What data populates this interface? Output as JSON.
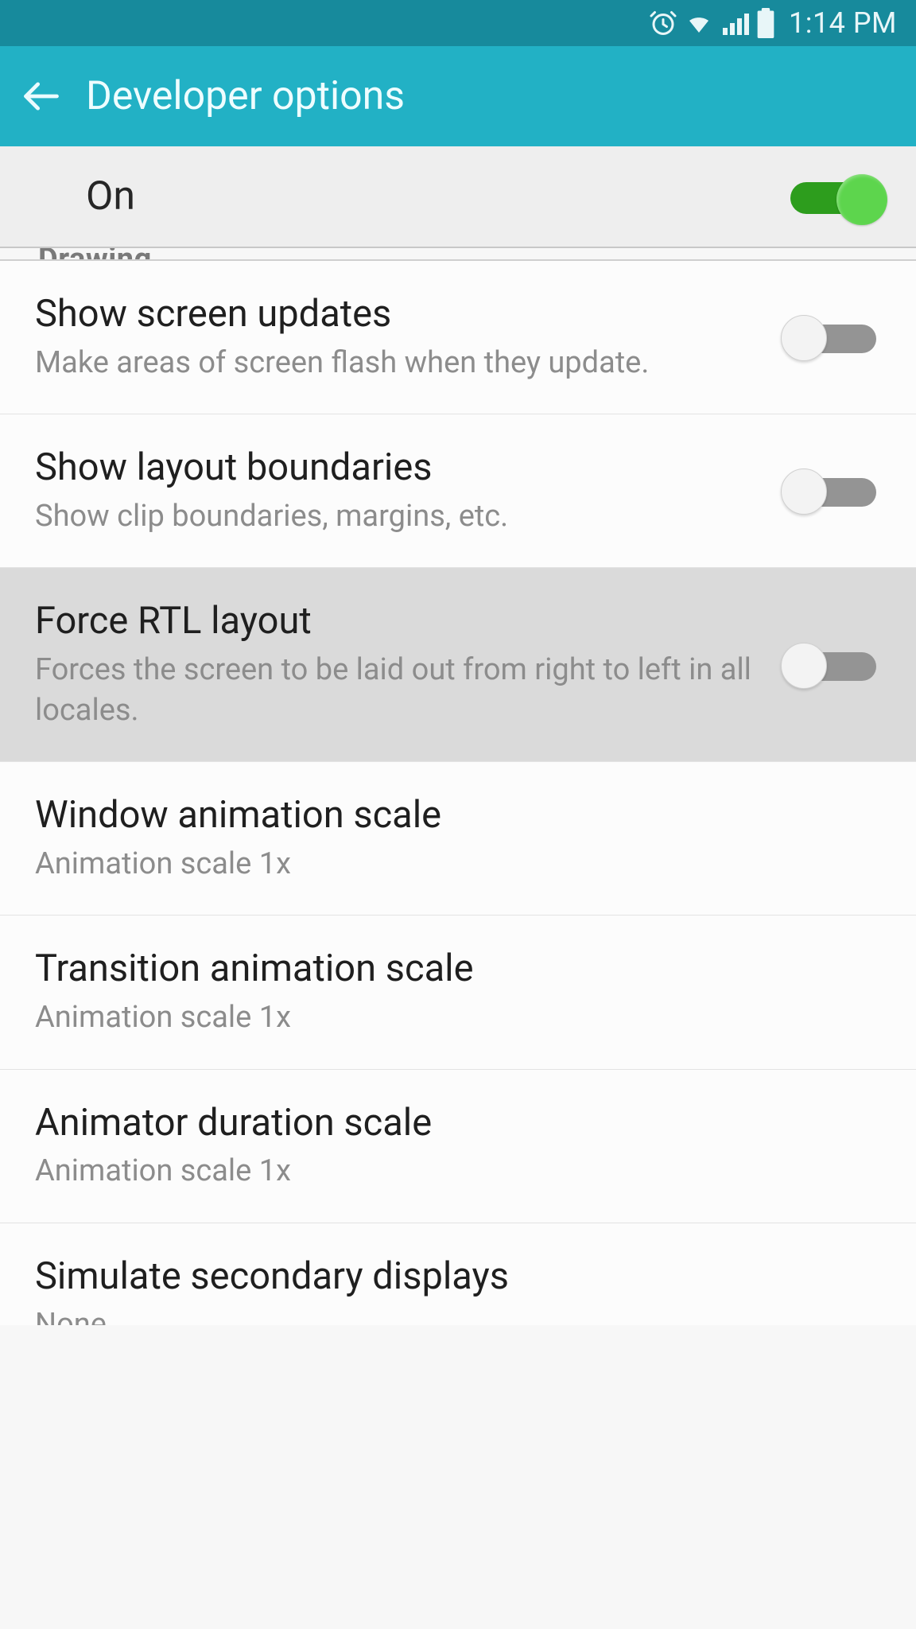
{
  "status": {
    "time": "1:14 PM"
  },
  "header": {
    "title": "Developer options"
  },
  "master": {
    "label": "On"
  },
  "section_partial": "Drawing",
  "items": [
    {
      "title": "Show screen updates",
      "sub": "Make areas of screen flash when they update."
    },
    {
      "title": "Show layout boundaries",
      "sub": "Show clip boundaries, margins, etc."
    },
    {
      "title": "Force RTL layout",
      "sub": "Forces the screen to be laid out from right to left in all locales."
    },
    {
      "title": "Window animation scale",
      "sub": "Animation scale 1x"
    },
    {
      "title": "Transition animation scale",
      "sub": "Animation scale 1x"
    },
    {
      "title": "Animator duration scale",
      "sub": "Animation scale 1x"
    },
    {
      "title": "Simulate secondary displays",
      "sub": "None"
    }
  ]
}
